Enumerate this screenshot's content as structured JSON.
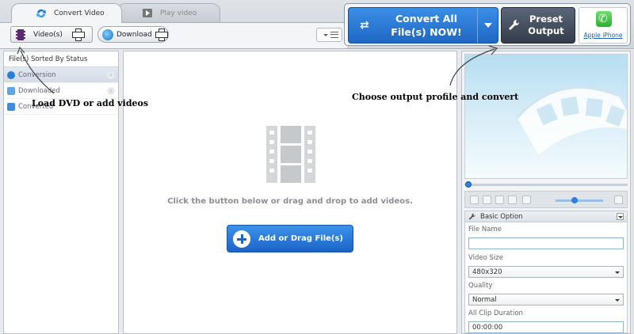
{
  "tabs": [
    {
      "label": "Convert Video",
      "active": true
    },
    {
      "label": "Play video",
      "active": false
    }
  ],
  "toolbar": {
    "videos_label": "Video(s)",
    "download_label": "Download"
  },
  "convert_all": {
    "line1": "Convert All",
    "line2": "File(s) NOW!"
  },
  "preset": {
    "line1": "Preset",
    "line2": "Output"
  },
  "device": {
    "label": "Apple iPhone"
  },
  "sidebar": {
    "header": "File(s) Sorted By Status",
    "items": [
      {
        "label": "Conversion",
        "active": true
      },
      {
        "label": "Downloaded",
        "active": false
      },
      {
        "label": "Converted",
        "active": false
      }
    ]
  },
  "main": {
    "hint": "Click the button below or drag and drop to add videos.",
    "add_button": "Add or Drag File(s)"
  },
  "options": {
    "header": "Basic Option",
    "file_name_label": "File Name",
    "file_name_value": "",
    "video_size_label": "Video Size",
    "video_size_value": "480x320",
    "quality_label": "Quality",
    "quality_value": "Normal",
    "clip_duration_label": "All Clip Duration",
    "clip_duration_value": "00:00:00"
  },
  "annotations": {
    "left": "Load DVD or add videos",
    "right": "Choose output profile and convert"
  },
  "colors": {
    "accent_blue": "#1f67c4",
    "preset_dark": "#343c48",
    "phone_green": "#2fae2f"
  }
}
